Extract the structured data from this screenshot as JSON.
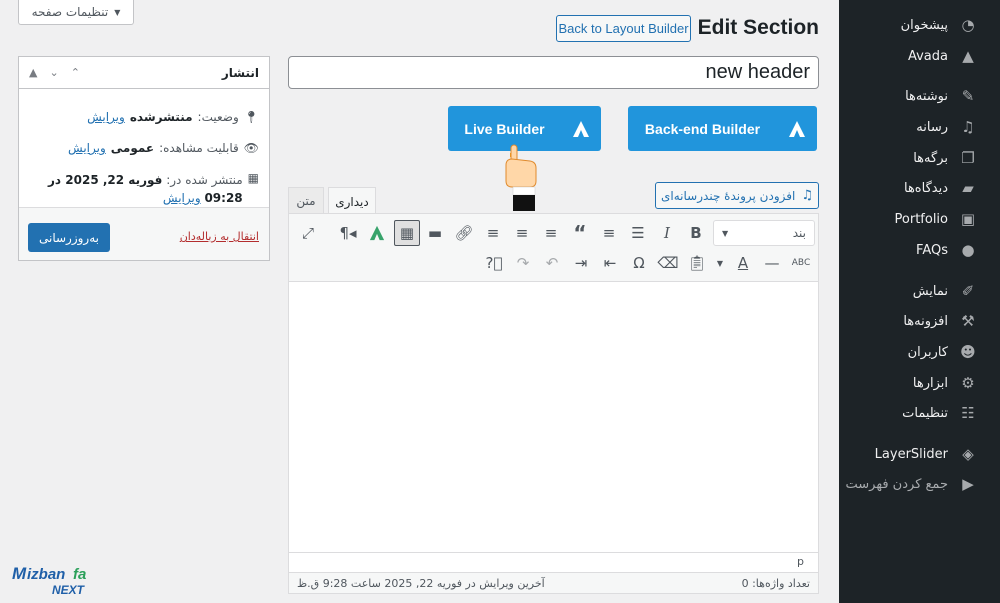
{
  "sidebar": {
    "items": [
      {
        "label": "پیشخوان",
        "icon": "dashboard-icon"
      },
      {
        "label": "Avada",
        "icon": "avada-icon"
      },
      {
        "label": "نوشته‌ها",
        "icon": "pin-icon"
      },
      {
        "label": "رسانه",
        "icon": "media-icon"
      },
      {
        "label": "برگه‌ها",
        "icon": "pages-icon"
      },
      {
        "label": "دیدگاه‌ها",
        "icon": "comments-icon"
      },
      {
        "label": "Portfolio",
        "icon": "portfolio-icon"
      },
      {
        "label": "FAQs",
        "icon": "faq-icon"
      },
      {
        "label": "نمایش",
        "icon": "brush-icon"
      },
      {
        "label": "افزونه‌ها",
        "icon": "plugins-icon"
      },
      {
        "label": "کاربران",
        "icon": "users-icon"
      },
      {
        "label": "ابزارها",
        "icon": "tools-icon"
      },
      {
        "label": "تنظیمات",
        "icon": "settings-icon"
      },
      {
        "label": "LayerSlider",
        "icon": "layers-icon"
      },
      {
        "label": "جمع کردن فهرست",
        "icon": "collapse-icon"
      }
    ]
  },
  "header": {
    "page_settings_label": "تنظیمات صفحه",
    "title": "Edit Section",
    "back_button": "Back to Layout Builder"
  },
  "post": {
    "title_value": "new header",
    "live_builder": "Live Builder",
    "backend_builder": "Back-end Builder"
  },
  "editor": {
    "add_media": "افزودن پروندهٔ چندرسانه‌ای",
    "tab_visual": "دیداری",
    "tab_text": "متن",
    "format_select": "بند",
    "path": "p",
    "word_count": "تعداد واژه‌ها: 0",
    "last_edited": "آخرین ویرایش در فوریه 22, 2025 ساعت 9:28 ق.ظ"
  },
  "publish": {
    "heading": "انتشار",
    "status_label": "وضعیت:",
    "status_value": "منتشرشده",
    "visibility_label": "قابلیت مشاهده:",
    "visibility_value": "عمومی",
    "published_label": "منتشر شده در:",
    "published_date": "فوریه 22, 2025 در",
    "published_time": "09:28",
    "edit_link": "ویرایش",
    "trash_link": "انتقال به زباله‌دان",
    "update_button": "به‌روزرسانی"
  },
  "brand": {
    "logo_top": "Mizbanfa",
    "logo_bottom": "NEXT"
  },
  "colors": {
    "sidebar_bg": "#1d2327",
    "builder_blue": "#2195dc",
    "wp_blue": "#2271b1",
    "trash_red": "#b32d2e"
  }
}
